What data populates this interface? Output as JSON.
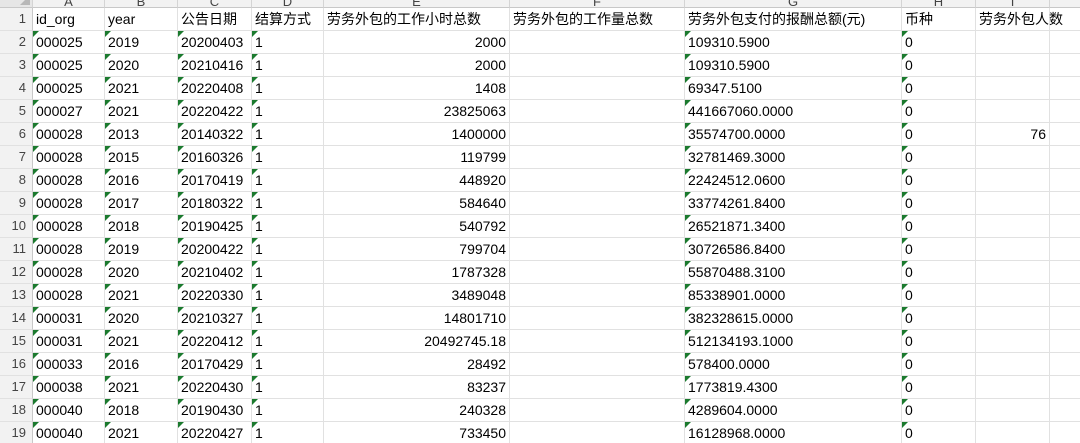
{
  "columns": [
    {
      "letter": "A",
      "header": "id_org",
      "width": 72
    },
    {
      "letter": "B",
      "header": "year",
      "width": 73
    },
    {
      "letter": "C",
      "header": "公告日期",
      "width": 74
    },
    {
      "letter": "D",
      "header": "结算方式",
      "width": 72
    },
    {
      "letter": "E",
      "header": "劳务外包的工作小时总数",
      "width": 186
    },
    {
      "letter": "F",
      "header": "劳务外包的工作量总数",
      "width": 175
    },
    {
      "letter": "G",
      "header": "劳务外包支付的报酬总额(元)",
      "width": 217
    },
    {
      "letter": "H",
      "header": "币种",
      "width": 74
    },
    {
      "letter": "I",
      "header": "劳务外包人数",
      "width": 74
    }
  ],
  "header_row_number": "1",
  "rows": [
    {
      "n": "2",
      "id_org": "000025",
      "year": "2019",
      "date": "20200403",
      "settle": "1",
      "hours": "2000",
      "workload": "",
      "pay": "109310.5900",
      "currency": "0",
      "people": ""
    },
    {
      "n": "3",
      "id_org": "000025",
      "year": "2020",
      "date": "20210416",
      "settle": "1",
      "hours": "2000",
      "workload": "",
      "pay": "109310.5900",
      "currency": "0",
      "people": ""
    },
    {
      "n": "4",
      "id_org": "000025",
      "year": "2021",
      "date": "20220408",
      "settle": "1",
      "hours": "1408",
      "workload": "",
      "pay": "69347.5100",
      "currency": "0",
      "people": ""
    },
    {
      "n": "5",
      "id_org": "000027",
      "year": "2021",
      "date": "20220422",
      "settle": "1",
      "hours": "23825063",
      "workload": "",
      "pay": "441667060.0000",
      "currency": "0",
      "people": ""
    },
    {
      "n": "6",
      "id_org": "000028",
      "year": "2013",
      "date": "20140322",
      "settle": "1",
      "hours": "1400000",
      "workload": "",
      "pay": "35574700.0000",
      "currency": "0",
      "people": "76"
    },
    {
      "n": "7",
      "id_org": "000028",
      "year": "2015",
      "date": "20160326",
      "settle": "1",
      "hours": "119799",
      "workload": "",
      "pay": "32781469.3000",
      "currency": "0",
      "people": ""
    },
    {
      "n": "8",
      "id_org": "000028",
      "year": "2016",
      "date": "20170419",
      "settle": "1",
      "hours": "448920",
      "workload": "",
      "pay": "22424512.0600",
      "currency": "0",
      "people": ""
    },
    {
      "n": "9",
      "id_org": "000028",
      "year": "2017",
      "date": "20180322",
      "settle": "1",
      "hours": "584640",
      "workload": "",
      "pay": "33774261.8400",
      "currency": "0",
      "people": ""
    },
    {
      "n": "10",
      "id_org": "000028",
      "year": "2018",
      "date": "20190425",
      "settle": "1",
      "hours": "540792",
      "workload": "",
      "pay": "26521871.3400",
      "currency": "0",
      "people": ""
    },
    {
      "n": "11",
      "id_org": "000028",
      "year": "2019",
      "date": "20200422",
      "settle": "1",
      "hours": "799704",
      "workload": "",
      "pay": "30726586.8400",
      "currency": "0",
      "people": ""
    },
    {
      "n": "12",
      "id_org": "000028",
      "year": "2020",
      "date": "20210402",
      "settle": "1",
      "hours": "1787328",
      "workload": "",
      "pay": "55870488.3100",
      "currency": "0",
      "people": ""
    },
    {
      "n": "13",
      "id_org": "000028",
      "year": "2021",
      "date": "20220330",
      "settle": "1",
      "hours": "3489048",
      "workload": "",
      "pay": "85338901.0000",
      "currency": "0",
      "people": ""
    },
    {
      "n": "14",
      "id_org": "000031",
      "year": "2020",
      "date": "20210327",
      "settle": "1",
      "hours": "14801710",
      "workload": "",
      "pay": "382328615.0000",
      "currency": "0",
      "people": ""
    },
    {
      "n": "15",
      "id_org": "000031",
      "year": "2021",
      "date": "20220412",
      "settle": "1",
      "hours": "20492745.18",
      "workload": "",
      "pay": "512134193.1000",
      "currency": "0",
      "people": ""
    },
    {
      "n": "16",
      "id_org": "000033",
      "year": "2016",
      "date": "20170429",
      "settle": "1",
      "hours": "28492",
      "workload": "",
      "pay": "578400.0000",
      "currency": "0",
      "people": ""
    },
    {
      "n": "17",
      "id_org": "000038",
      "year": "2021",
      "date": "20220430",
      "settle": "1",
      "hours": "83237",
      "workload": "",
      "pay": "1773819.4300",
      "currency": "0",
      "people": ""
    },
    {
      "n": "18",
      "id_org": "000040",
      "year": "2018",
      "date": "20190430",
      "settle": "1",
      "hours": "240328",
      "workload": "",
      "pay": "4289604.0000",
      "currency": "0",
      "people": ""
    },
    {
      "n": "19",
      "id_org": "000040",
      "year": "2021",
      "date": "20220427",
      "settle": "1",
      "hours": "733450",
      "workload": "",
      "pay": "16128968.0000",
      "currency": "0",
      "people": ""
    }
  ],
  "colors": {
    "text_marker": "#1b7a2e",
    "grid": "#e1e1e1",
    "header_bg": "#f2f2f2"
  }
}
